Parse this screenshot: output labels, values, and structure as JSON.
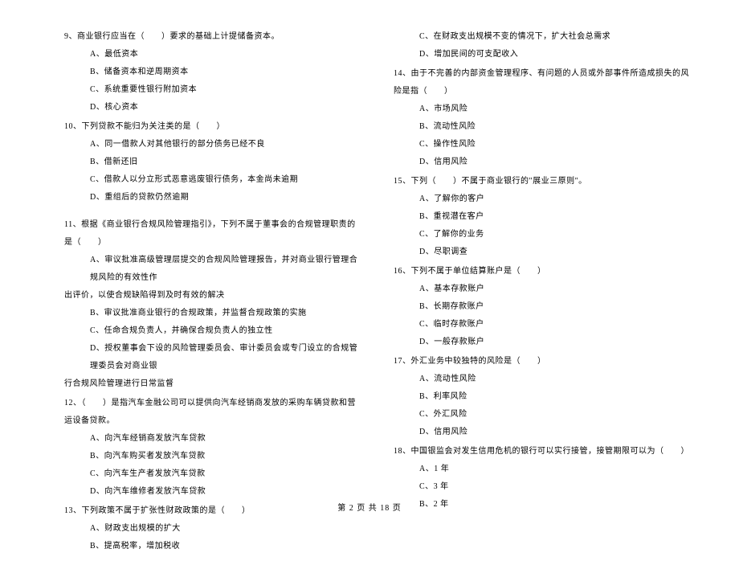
{
  "left_column": {
    "q9": {
      "text": "9、商业银行应当在（　　）要求的基础上计提储备资本。",
      "options": {
        "a": "A、最低资本",
        "b": "B、储备资本和逆周期资本",
        "c": "C、系统重要性银行附加资本",
        "d": "D、核心资本"
      }
    },
    "q10": {
      "text": "10、下列贷款不能归为关注类的是（　　）",
      "options": {
        "a": "A、同一借款人对其他银行的部分债务已经不良",
        "b": "B、借新还旧",
        "c": "C、借款人以分立形式恶意逃废银行债务，本金尚未逾期",
        "d": "D、重组后的贷款仍然逾期"
      }
    },
    "q11": {
      "text": "11、根据《商业银行合规风险管理指引》，下列不属于董事会的合规管理职责的是（　　）",
      "options": {
        "a_line1": "A、审议批准高级管理层提交的合规风险管理报告，并对商业银行管理合规风险的有效性作",
        "a_line2": "出评价，以使合规缺陷得到及时有效的解决",
        "b": "B、审议批准商业银行的合规政策，并监督合规政策的实施",
        "c": "C、任命合规负责人，并确保合规负责人的独立性",
        "d_line1": "D、授权董事会下设的风险管理委员会、审计委员会或专门设立的合规管理委员会对商业银",
        "d_line2": "行合规风险管理进行日常监督"
      }
    },
    "q12": {
      "text": "12、（　　）是指汽车金融公司可以提供向汽车经销商发放的采购车辆贷款和营运设备贷款。",
      "options": {
        "a": "A、向汽车经销商发放汽车贷款",
        "b": "B、向汽车购买者发放汽车贷款",
        "c": "C、向汽车生产者发放汽车贷款",
        "d": "D、向汽车维修者发放汽车贷款"
      }
    },
    "q13": {
      "text": "13、下列政策不属于扩张性财政政策的是（　　）",
      "options": {
        "a": "A、财政支出规模的扩大",
        "b": "B、提高税率，增加税收"
      }
    }
  },
  "right_column": {
    "q13_cont": {
      "options": {
        "c": "C、在财政支出规模不变的情况下，扩大社会总需求",
        "d": "D、增加民间的可支配收入"
      }
    },
    "q14": {
      "text": "14、由于不完善的内部资金管理程序、有问题的人员或外部事件所造成损失的风险是指（　　）",
      "options": {
        "a": "A、市场风险",
        "b": "B、流动性风险",
        "c": "C、操作性风险",
        "d": "D、信用风险"
      }
    },
    "q15": {
      "text": "15、下列（　　）不属于商业银行的\"展业三原则\"。",
      "options": {
        "a": "A、了解你的客户",
        "b": "B、重视潜在客户",
        "c": "C、了解你的业务",
        "d": "D、尽职调查"
      }
    },
    "q16": {
      "text": "16、下列不属于单位结算账户是（　　）",
      "options": {
        "a": "A、基本存款账户",
        "b": "B、长期存款账户",
        "c": "C、临时存款账户",
        "d": "D、一般存款账户"
      }
    },
    "q17": {
      "text": "17、外汇业务中较独特的风险是（　　）",
      "options": {
        "a": "A、流动性风险",
        "b": "B、利率风险",
        "c": "C、外汇风险",
        "d": "D、信用风险"
      }
    },
    "q18": {
      "text": "18、中国银监会对发生信用危机的银行可以实行接管，接管期限可以为（　　）",
      "options": {
        "a": "A、1 年",
        "c": "C、3 年",
        "b": "B、2 年"
      }
    }
  },
  "footer": "第 2 页 共 18 页"
}
